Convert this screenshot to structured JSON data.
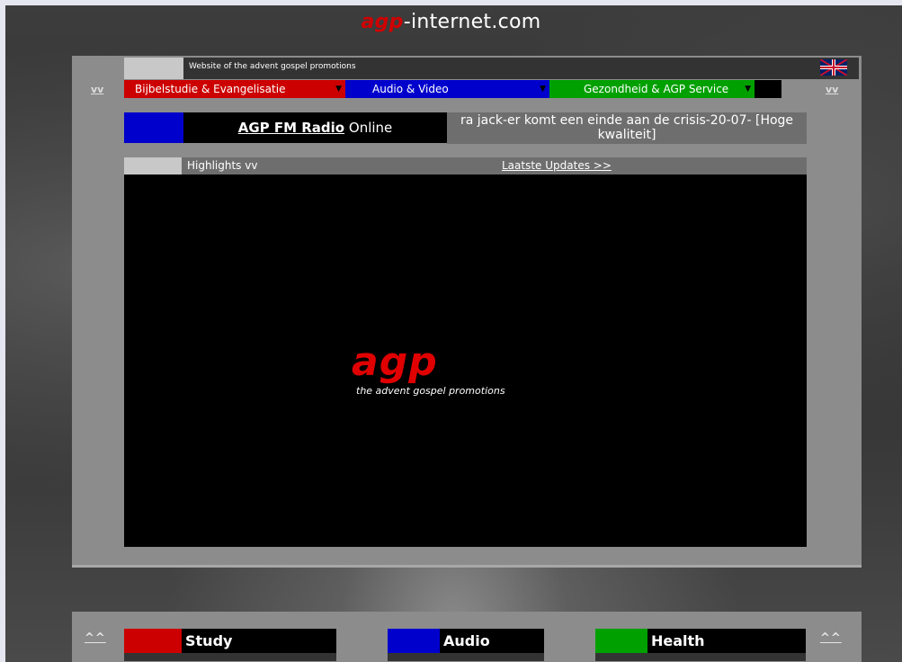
{
  "header": {
    "brand": "agp",
    "domain_suffix": "-internet.com"
  },
  "topbar": {
    "tagline": "Website of the advent gospel promotions",
    "flag_icon": "uk-flag-icon"
  },
  "side_links": {
    "left": "vv",
    "right": "vv"
  },
  "nav": {
    "items": [
      {
        "label": "Bijbelstudie & Evangelisatie",
        "color": "#cc0000"
      },
      {
        "label": "Audio & Video",
        "color": "#0000cc"
      },
      {
        "label": "Gezondheid & AGP Service",
        "color": "#00a000"
      }
    ]
  },
  "radio": {
    "link": "AGP FM Radio",
    "suffix": "Online",
    "now_playing": "ra jack-er komt een einde aan de crisis-20-07- [Hoge kwaliteit]"
  },
  "highlights": {
    "label": "Highlights vv",
    "updates_link": "Laatste Updates >>"
  },
  "logo": {
    "text": "agp",
    "subtitle": "the advent gospel promotions"
  },
  "bottom": {
    "up_left": "^^",
    "up_right": "^^",
    "cards": [
      {
        "label": "Study",
        "color": "#cc0000"
      },
      {
        "label": "Audio",
        "color": "#0000cc"
      },
      {
        "label": "Health",
        "color": "#00a000"
      }
    ]
  }
}
